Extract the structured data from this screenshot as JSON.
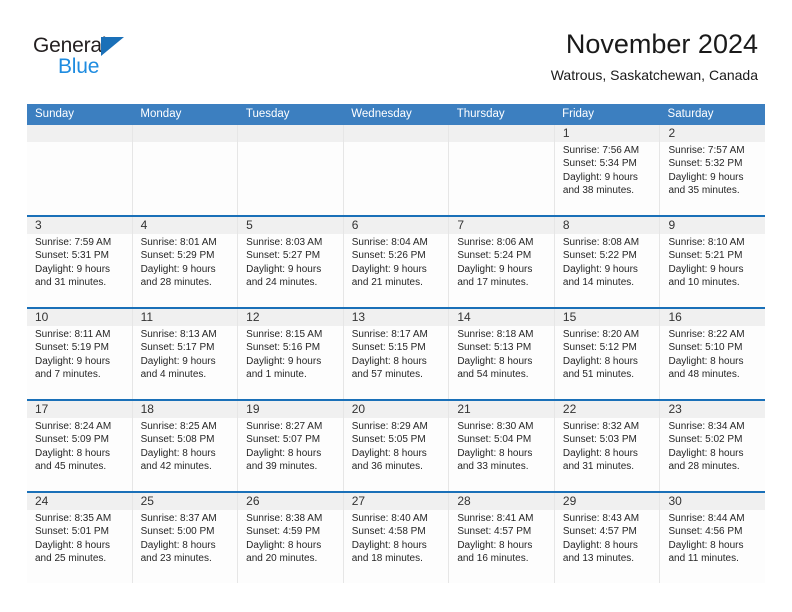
{
  "brand": {
    "line1": "General",
    "line2": "Blue",
    "triangle_color": "#1a70b8",
    "line2_color": "#1f8ce0"
  },
  "header": {
    "title": "November 2024",
    "subtitle": "Watrous, Saskatchewan, Canada"
  },
  "theme": {
    "header_bg": "#3c7fc0",
    "row_divider": "#1a70b8",
    "date_band": "#f0f0f0"
  },
  "calendar": {
    "weekdays": [
      "Sunday",
      "Monday",
      "Tuesday",
      "Wednesday",
      "Thursday",
      "Friday",
      "Saturday"
    ],
    "weeks": [
      [
        {
          "day": "",
          "empty": true
        },
        {
          "day": "",
          "empty": true
        },
        {
          "day": "",
          "empty": true
        },
        {
          "day": "",
          "empty": true
        },
        {
          "day": "",
          "empty": true
        },
        {
          "day": "1",
          "sunrise": "Sunrise: 7:56 AM",
          "sunset": "Sunset: 5:34 PM",
          "daylight1": "Daylight: 9 hours",
          "daylight2": "and 38 minutes."
        },
        {
          "day": "2",
          "sunrise": "Sunrise: 7:57 AM",
          "sunset": "Sunset: 5:32 PM",
          "daylight1": "Daylight: 9 hours",
          "daylight2": "and 35 minutes."
        }
      ],
      [
        {
          "day": "3",
          "sunrise": "Sunrise: 7:59 AM",
          "sunset": "Sunset: 5:31 PM",
          "daylight1": "Daylight: 9 hours",
          "daylight2": "and 31 minutes."
        },
        {
          "day": "4",
          "sunrise": "Sunrise: 8:01 AM",
          "sunset": "Sunset: 5:29 PM",
          "daylight1": "Daylight: 9 hours",
          "daylight2": "and 28 minutes."
        },
        {
          "day": "5",
          "sunrise": "Sunrise: 8:03 AM",
          "sunset": "Sunset: 5:27 PM",
          "daylight1": "Daylight: 9 hours",
          "daylight2": "and 24 minutes."
        },
        {
          "day": "6",
          "sunrise": "Sunrise: 8:04 AM",
          "sunset": "Sunset: 5:26 PM",
          "daylight1": "Daylight: 9 hours",
          "daylight2": "and 21 minutes."
        },
        {
          "day": "7",
          "sunrise": "Sunrise: 8:06 AM",
          "sunset": "Sunset: 5:24 PM",
          "daylight1": "Daylight: 9 hours",
          "daylight2": "and 17 minutes."
        },
        {
          "day": "8",
          "sunrise": "Sunrise: 8:08 AM",
          "sunset": "Sunset: 5:22 PM",
          "daylight1": "Daylight: 9 hours",
          "daylight2": "and 14 minutes."
        },
        {
          "day": "9",
          "sunrise": "Sunrise: 8:10 AM",
          "sunset": "Sunset: 5:21 PM",
          "daylight1": "Daylight: 9 hours",
          "daylight2": "and 10 minutes."
        }
      ],
      [
        {
          "day": "10",
          "sunrise": "Sunrise: 8:11 AM",
          "sunset": "Sunset: 5:19 PM",
          "daylight1": "Daylight: 9 hours",
          "daylight2": "and 7 minutes."
        },
        {
          "day": "11",
          "sunrise": "Sunrise: 8:13 AM",
          "sunset": "Sunset: 5:17 PM",
          "daylight1": "Daylight: 9 hours",
          "daylight2": "and 4 minutes."
        },
        {
          "day": "12",
          "sunrise": "Sunrise: 8:15 AM",
          "sunset": "Sunset: 5:16 PM",
          "daylight1": "Daylight: 9 hours",
          "daylight2": "and 1 minute."
        },
        {
          "day": "13",
          "sunrise": "Sunrise: 8:17 AM",
          "sunset": "Sunset: 5:15 PM",
          "daylight1": "Daylight: 8 hours",
          "daylight2": "and 57 minutes."
        },
        {
          "day": "14",
          "sunrise": "Sunrise: 8:18 AM",
          "sunset": "Sunset: 5:13 PM",
          "daylight1": "Daylight: 8 hours",
          "daylight2": "and 54 minutes."
        },
        {
          "day": "15",
          "sunrise": "Sunrise: 8:20 AM",
          "sunset": "Sunset: 5:12 PM",
          "daylight1": "Daylight: 8 hours",
          "daylight2": "and 51 minutes."
        },
        {
          "day": "16",
          "sunrise": "Sunrise: 8:22 AM",
          "sunset": "Sunset: 5:10 PM",
          "daylight1": "Daylight: 8 hours",
          "daylight2": "and 48 minutes."
        }
      ],
      [
        {
          "day": "17",
          "sunrise": "Sunrise: 8:24 AM",
          "sunset": "Sunset: 5:09 PM",
          "daylight1": "Daylight: 8 hours",
          "daylight2": "and 45 minutes."
        },
        {
          "day": "18",
          "sunrise": "Sunrise: 8:25 AM",
          "sunset": "Sunset: 5:08 PM",
          "daylight1": "Daylight: 8 hours",
          "daylight2": "and 42 minutes."
        },
        {
          "day": "19",
          "sunrise": "Sunrise: 8:27 AM",
          "sunset": "Sunset: 5:07 PM",
          "daylight1": "Daylight: 8 hours",
          "daylight2": "and 39 minutes."
        },
        {
          "day": "20",
          "sunrise": "Sunrise: 8:29 AM",
          "sunset": "Sunset: 5:05 PM",
          "daylight1": "Daylight: 8 hours",
          "daylight2": "and 36 minutes."
        },
        {
          "day": "21",
          "sunrise": "Sunrise: 8:30 AM",
          "sunset": "Sunset: 5:04 PM",
          "daylight1": "Daylight: 8 hours",
          "daylight2": "and 33 minutes."
        },
        {
          "day": "22",
          "sunrise": "Sunrise: 8:32 AM",
          "sunset": "Sunset: 5:03 PM",
          "daylight1": "Daylight: 8 hours",
          "daylight2": "and 31 minutes."
        },
        {
          "day": "23",
          "sunrise": "Sunrise: 8:34 AM",
          "sunset": "Sunset: 5:02 PM",
          "daylight1": "Daylight: 8 hours",
          "daylight2": "and 28 minutes."
        }
      ],
      [
        {
          "day": "24",
          "sunrise": "Sunrise: 8:35 AM",
          "sunset": "Sunset: 5:01 PM",
          "daylight1": "Daylight: 8 hours",
          "daylight2": "and 25 minutes."
        },
        {
          "day": "25",
          "sunrise": "Sunrise: 8:37 AM",
          "sunset": "Sunset: 5:00 PM",
          "daylight1": "Daylight: 8 hours",
          "daylight2": "and 23 minutes."
        },
        {
          "day": "26",
          "sunrise": "Sunrise: 8:38 AM",
          "sunset": "Sunset: 4:59 PM",
          "daylight1": "Daylight: 8 hours",
          "daylight2": "and 20 minutes."
        },
        {
          "day": "27",
          "sunrise": "Sunrise: 8:40 AM",
          "sunset": "Sunset: 4:58 PM",
          "daylight1": "Daylight: 8 hours",
          "daylight2": "and 18 minutes."
        },
        {
          "day": "28",
          "sunrise": "Sunrise: 8:41 AM",
          "sunset": "Sunset: 4:57 PM",
          "daylight1": "Daylight: 8 hours",
          "daylight2": "and 16 minutes."
        },
        {
          "day": "29",
          "sunrise": "Sunrise: 8:43 AM",
          "sunset": "Sunset: 4:57 PM",
          "daylight1": "Daylight: 8 hours",
          "daylight2": "and 13 minutes."
        },
        {
          "day": "30",
          "sunrise": "Sunrise: 8:44 AM",
          "sunset": "Sunset: 4:56 PM",
          "daylight1": "Daylight: 8 hours",
          "daylight2": "and 11 minutes."
        }
      ]
    ]
  }
}
